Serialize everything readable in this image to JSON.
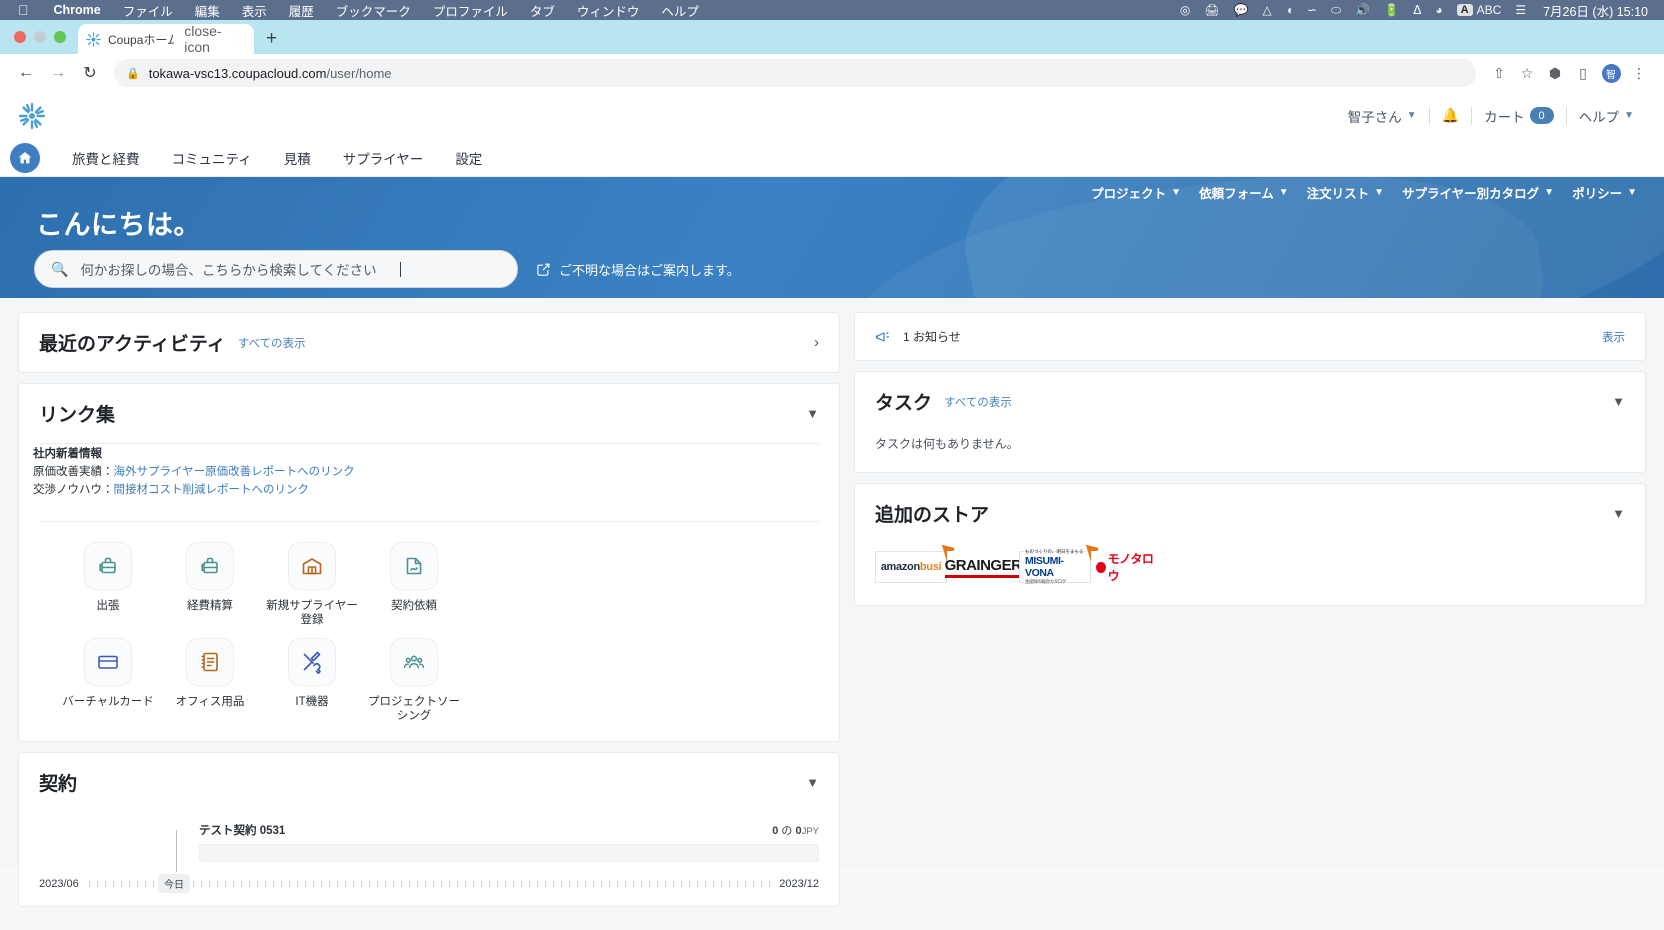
{
  "os_menu": {
    "apple_icon": "apple-icon",
    "items": [
      {
        "label": "Chrome",
        "bold": true
      },
      {
        "label": "ファイル",
        "bold": false
      },
      {
        "label": "編集",
        "bold": false
      },
      {
        "label": "表示",
        "bold": false
      },
      {
        "label": "履歴",
        "bold": false
      },
      {
        "label": "ブックマーク",
        "bold": false
      },
      {
        "label": "プロファイル",
        "bold": false
      },
      {
        "label": "タブ",
        "bold": false
      },
      {
        "label": "ウィンドウ",
        "bold": false
      },
      {
        "label": "ヘルプ",
        "bold": false
      }
    ],
    "status_icons": [
      "crosshair-icon",
      "printer-icon",
      "messenger-icon",
      "drive-icon",
      "contrast-icon",
      "wave-icon",
      "ellipse-icon",
      "volume-icon",
      "battery-charging-icon",
      "bluetooth-icon",
      "wifi-icon"
    ],
    "input_source": "A",
    "input_label": "ABC",
    "control_center_icon": "control-center-icon",
    "clock": "7月26日 (水) 15:10"
  },
  "browser": {
    "tab": {
      "title": "Coupaホーム",
      "favicon": "coupa-favicon",
      "close_icon": "close-icon"
    },
    "new_tab_icon": "+",
    "back_icon": "←",
    "forward_icon": "→",
    "reload_icon": "⟳",
    "lock_icon": "lock-icon",
    "url_host": "tokawa-vsc13.coupacloud.com",
    "url_path": "/user/home",
    "share_icon": "share-icon",
    "bookmark_icon": "star-icon",
    "extensions_icon": "puzzle-icon",
    "sidepanel_icon": "side-panel-icon",
    "profile_initial": "智",
    "menu_icon": "kebab-menu-icon",
    "window_chevron_icon": "chevron-down-icon"
  },
  "app_header": {
    "logo": "coupa-logo",
    "user_name": "智子さん",
    "notifications_icon": "bell-icon",
    "cart_label": "カート",
    "cart_count": "0",
    "help_label": "ヘルプ"
  },
  "main_nav": {
    "home_icon": "home-icon",
    "items": [
      {
        "label": "旅費と経費"
      },
      {
        "label": "コミュニティ"
      },
      {
        "label": "見積"
      },
      {
        "label": "サプライヤー"
      },
      {
        "label": "設定"
      }
    ]
  },
  "hero": {
    "greeting": "こんにちは。",
    "search_placeholder": "何かお探しの場合、こちらから検索してください",
    "search_value": "",
    "search_icon": "search-icon",
    "help_link_icon": "edit-square-icon",
    "help_link_label": "ご不明な場合はご案内します。",
    "sub_nav": [
      {
        "label": "プロジェクト"
      },
      {
        "label": "依頼フォーム"
      },
      {
        "label": "注文リスト"
      },
      {
        "label": "サプライヤー別カタログ"
      },
      {
        "label": "ポリシー"
      }
    ]
  },
  "recent_activity": {
    "title": "最近のアクティビティ",
    "view_all": "すべての表示",
    "expand_icon": "chevron-right-icon"
  },
  "links_card": {
    "title": "リンク集",
    "collapse_icon": "chevron-down-icon",
    "section_label": "社内新着情報",
    "rows": [
      {
        "prefix": "原価改善実績：",
        "link": "海外サプライヤー原価改善レポートへのリンク"
      },
      {
        "prefix": "交渉ノウハウ：",
        "link": "間接材コスト削減レポートへのリンク"
      }
    ],
    "shortcuts": [
      {
        "label": "出張",
        "icon": "luggage-icon",
        "color": "#4c9090"
      },
      {
        "label": "経費精算",
        "icon": "luggage-icon",
        "color": "#4c9090"
      },
      {
        "label": "新規サプライヤー登録",
        "icon": "warehouse-icon",
        "color": "#b5651d"
      },
      {
        "label": "契約依頼",
        "icon": "contract-signature-icon",
        "color": "#4c9090"
      },
      {
        "label": "バーチャルカード",
        "icon": "credit-card-icon",
        "color": "#3b5bb5"
      },
      {
        "label": "オフィス用品",
        "icon": "notebook-icon",
        "color": "#b5651d"
      },
      {
        "label": "IT機器",
        "icon": "tools-icon",
        "color": "#3b5bb5"
      },
      {
        "label": "プロジェクトソーシング",
        "icon": "people-group-icon",
        "color": "#4c9090"
      }
    ]
  },
  "contract_card": {
    "title": "契約",
    "collapse_icon": "chevron-down-icon",
    "item_name": "テスト契約 0531",
    "amount_used": "0",
    "amount_separator": "の",
    "amount_total": "0",
    "currency": "JPY",
    "today_label": "今日",
    "timeline_start": "2023/06",
    "timeline_end": "2023/12"
  },
  "notice_card": {
    "icon": "megaphone-icon",
    "count": "1",
    "label": "お知らせ",
    "action": "表示"
  },
  "task_card": {
    "title": "タスク",
    "view_all": "すべての表示",
    "collapse_icon": "chevron-down-icon",
    "empty_message": "タスクは何もありません。"
  },
  "store_card": {
    "title": "追加のストア",
    "collapse_icon": "chevron-down-icon",
    "stores": [
      {
        "name": "amazon business",
        "id": "amazon-business-logo"
      },
      {
        "name": "GRAINGER",
        "id": "grainger-logo"
      },
      {
        "name": "MISUMI-VONA",
        "id": "misumi-vona-logo",
        "tagline": "ものづくりの、明日をまもる",
        "sub": "生産財の総合カタログ"
      },
      {
        "name": "モノタロウ",
        "id": "monotaro-logo"
      }
    ]
  },
  "theme": {
    "accent_blue": "#3d7cc0",
    "hero_blue": "#3a82c4",
    "tabstrip_bg": "#b9e5f0",
    "menubar_bg": "#5b6f8c",
    "page_bg": "#f4f6f7"
  }
}
